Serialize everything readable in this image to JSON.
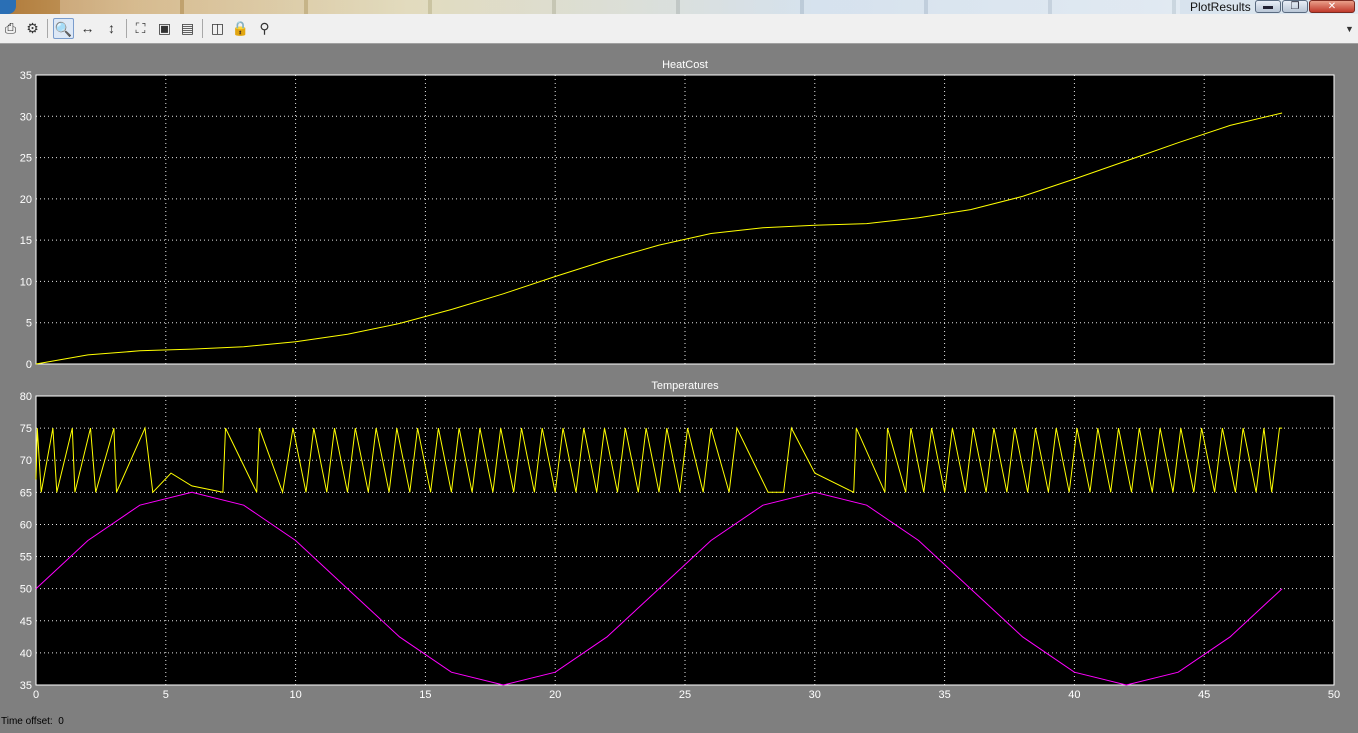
{
  "window": {
    "title": "PlotResults",
    "minimize": "▬",
    "maximize": "❐",
    "close": "✕"
  },
  "toolbar": {
    "items": [
      {
        "name": "print-icon",
        "glyph": "⎙"
      },
      {
        "name": "parameters-icon",
        "glyph": "⚙"
      },
      {
        "name": "zoom-icon",
        "glyph": "🔍"
      },
      {
        "name": "zoom-x-icon",
        "glyph": "↔"
      },
      {
        "name": "zoom-y-icon",
        "glyph": "↕"
      },
      {
        "name": "autoscale-icon",
        "glyph": "⛶"
      },
      {
        "name": "save-axes-icon",
        "glyph": "▣"
      },
      {
        "name": "restore-axes-icon",
        "glyph": "▤"
      },
      {
        "name": "floating-scope-icon",
        "glyph": "◫"
      },
      {
        "name": "lock-icon",
        "glyph": "🔒"
      },
      {
        "name": "signal-selection-icon",
        "glyph": "⚲"
      }
    ]
  },
  "status": {
    "time_offset_label": "Time offset:",
    "time_offset_value": "0"
  },
  "colors": {
    "background": "#000000",
    "grid": "#ffffff",
    "figure": "#7f7f7f",
    "yellow": "#ffff00",
    "magenta": "#ff00ff"
  },
  "chart_data": [
    {
      "type": "line",
      "title": "HeatCost",
      "xlim": [
        0,
        50
      ],
      "ylim": [
        0,
        35
      ],
      "xticks": [
        0,
        5,
        10,
        15,
        20,
        25,
        30,
        35,
        40,
        45,
        50
      ],
      "yticks": [
        0,
        5,
        10,
        15,
        20,
        25,
        30,
        35
      ],
      "show_xticklabels": false,
      "grid": true,
      "series": [
        {
          "color": "#ffff00",
          "x": [
            0,
            2,
            4,
            6,
            8,
            10,
            12,
            14,
            16,
            18,
            20,
            22,
            24,
            26,
            28,
            30,
            32,
            34,
            36,
            38,
            40,
            42,
            44,
            46,
            48
          ],
          "y": [
            0,
            1.1,
            1.6,
            1.8,
            2.1,
            2.7,
            3.6,
            4.9,
            6.6,
            8.5,
            10.6,
            12.6,
            14.4,
            15.8,
            16.5,
            16.8,
            17.0,
            17.7,
            18.7,
            20.3,
            22.4,
            24.6,
            26.8,
            28.9,
            30.4
          ]
        }
      ]
    },
    {
      "type": "line",
      "title": "Temperatures",
      "xlim": [
        0,
        50
      ],
      "ylim": [
        35,
        80
      ],
      "xticks": [
        0,
        5,
        10,
        15,
        20,
        25,
        30,
        35,
        40,
        45,
        50
      ],
      "yticks": [
        35,
        40,
        45,
        50,
        55,
        60,
        65,
        70,
        75,
        80
      ],
      "show_xticklabels": true,
      "grid": true,
      "series": [
        {
          "color": "#ffff00",
          "note_shape": "sawtooth",
          "x": [
            0,
            0.05,
            0.2,
            0.65,
            0.8,
            1.4,
            1.5,
            2.1,
            2.3,
            3.0,
            3.1,
            4.2,
            4.5,
            5.2,
            6.0,
            7.2,
            7.3,
            8.5,
            8.6,
            9.5,
            9.9,
            10.4,
            10.7,
            11.2,
            11.5,
            12.0,
            12.3,
            12.8,
            13.1,
            13.6,
            13.9,
            14.4,
            14.7,
            15.2,
            15.5,
            16.0,
            16.3,
            16.8,
            17.1,
            17.6,
            17.9,
            18.4,
            18.7,
            19.2,
            19.5,
            20.0,
            20.3,
            20.8,
            21.1,
            21.6,
            21.9,
            22.4,
            22.7,
            23.2,
            23.5,
            24.0,
            24.3,
            24.8,
            25.1,
            25.7,
            26.0,
            26.7,
            27.0,
            28.2,
            28.8,
            29.1,
            30.0,
            31.5,
            31.6,
            32.7,
            32.8,
            33.5,
            33.7,
            34.2,
            34.5,
            35.0,
            35.3,
            35.8,
            36.1,
            36.6,
            36.9,
            37.4,
            37.7,
            38.2,
            38.5,
            39.0,
            39.3,
            39.8,
            40.1,
            40.6,
            40.9,
            41.4,
            41.7,
            42.2,
            42.5,
            43.0,
            43.3,
            43.8,
            44.1,
            44.6,
            44.9,
            45.4,
            45.7,
            46.2,
            46.5,
            47.0,
            47.3,
            47.6,
            47.9,
            48.0
          ],
          "y": [
            67,
            75,
            65,
            75,
            65,
            75,
            65,
            75,
            65,
            75,
            65,
            75,
            65,
            68,
            66,
            65,
            75,
            65,
            75,
            65,
            75,
            65,
            75,
            65,
            75,
            65,
            75,
            65,
            75,
            65,
            75,
            65,
            75,
            65,
            75,
            65,
            75,
            65,
            75,
            65,
            75,
            65,
            75,
            65,
            75,
            65,
            75,
            65,
            75,
            65,
            75,
            65,
            75,
            65,
            75,
            65,
            75,
            65,
            75,
            65,
            75,
            65,
            75,
            65,
            65,
            75,
            68,
            65,
            75,
            65,
            75,
            65,
            75,
            65,
            75,
            65,
            75,
            65,
            75,
            65,
            75,
            65,
            75,
            65,
            75,
            65,
            75,
            65,
            75,
            65,
            75,
            65,
            75,
            65,
            75,
            65,
            75,
            65,
            75,
            65,
            75,
            65,
            75,
            65,
            75,
            65,
            75,
            65,
            75,
            75
          ]
        },
        {
          "color": "#ff00ff",
          "x": [
            0,
            2,
            4,
            6,
            8,
            10,
            12,
            14,
            16,
            18,
            20,
            22,
            24,
            26,
            28,
            30,
            32,
            34,
            36,
            38,
            40,
            42,
            44,
            46,
            48
          ],
          "y": [
            50,
            57.5,
            63.0,
            65.0,
            63.0,
            57.5,
            50.0,
            42.5,
            37.0,
            35.0,
            37.0,
            42.5,
            50.0,
            57.5,
            63.0,
            65.0,
            63.0,
            57.5,
            50.0,
            42.5,
            37.0,
            35.0,
            37.0,
            42.5,
            50.0
          ]
        }
      ]
    }
  ]
}
